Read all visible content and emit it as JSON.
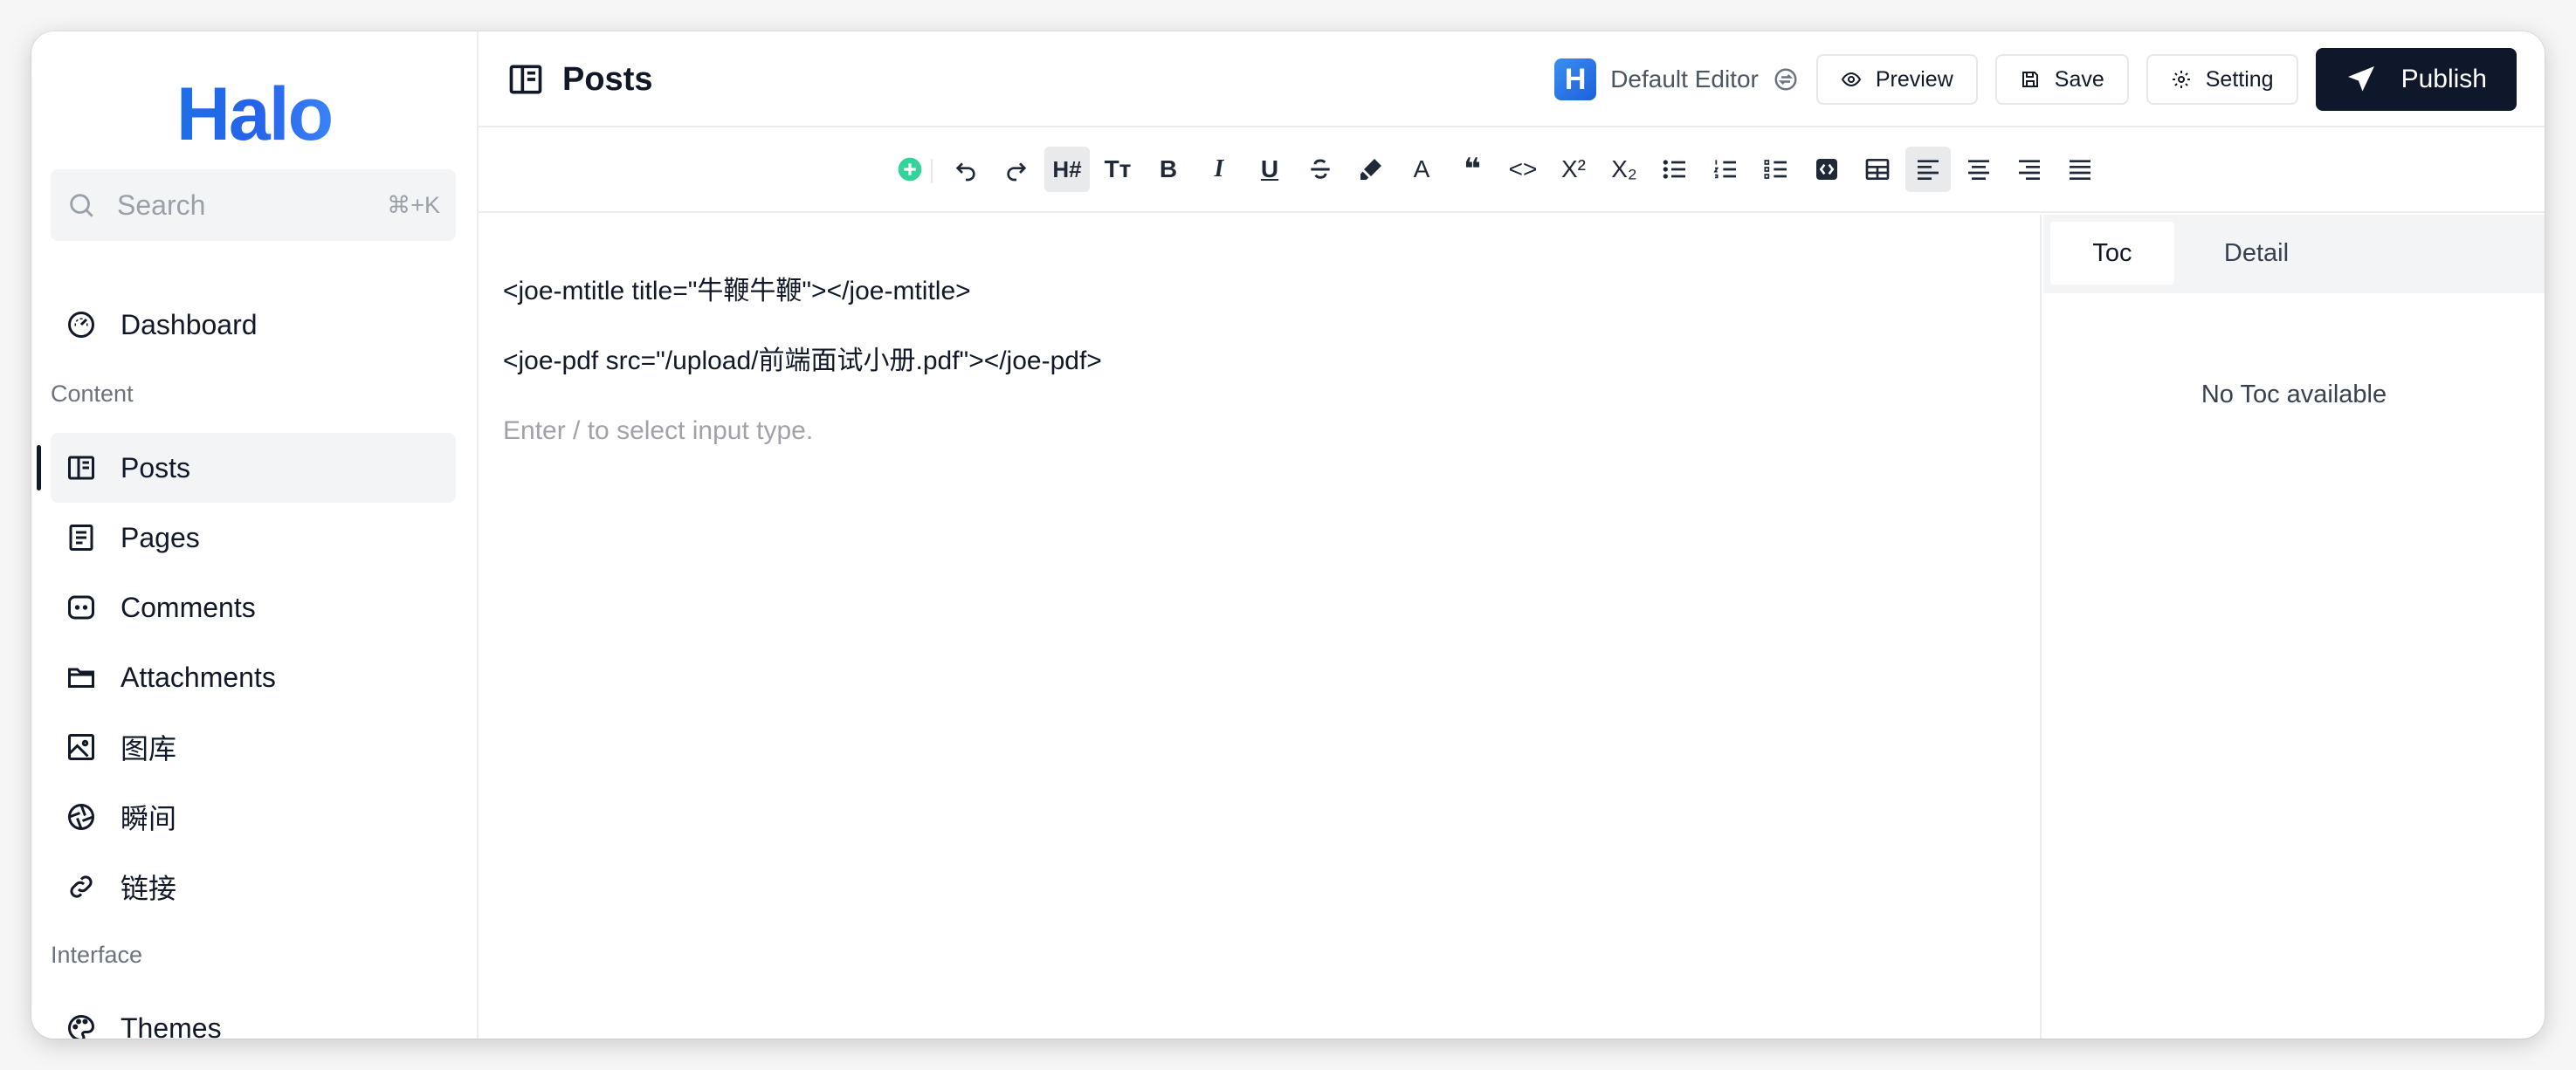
{
  "brand": {
    "logo_text": "Halo",
    "accent": "#2563eb"
  },
  "search": {
    "placeholder": "Search",
    "shortcut": "⌘+K"
  },
  "sidebar": {
    "dashboard": "Dashboard",
    "section_content": "Content",
    "items": [
      "Posts",
      "Pages",
      "Comments",
      "Attachments",
      "图库",
      "瞬间",
      "链接"
    ],
    "section_interface": "Interface",
    "themes": "Themes"
  },
  "header": {
    "title": "Posts",
    "editor_badge": "H",
    "editor_name": "Default Editor",
    "preview": "Preview",
    "save": "Save",
    "setting": "Setting",
    "publish": "Publish"
  },
  "toolbar": {
    "heading_label": "H#",
    "text_size_label": "Tт",
    "bold_label": "B",
    "italic_label": "I",
    "underline_label": "U",
    "text_color_label": "A",
    "quote_label": "❝",
    "code_label": "<>",
    "superscript_label": "X²",
    "subscript_label": "X₂",
    "icons": [
      "add-block-icon",
      "undo-icon",
      "redo-icon",
      "heading-icon",
      "text-size-icon",
      "bold-icon",
      "italic-icon",
      "underline-icon",
      "strikethrough-icon",
      "highlight-icon",
      "text-color-icon",
      "quote-icon",
      "code-icon",
      "superscript-icon",
      "subscript-icon",
      "bullet-list-icon",
      "ordered-list-icon",
      "task-list-icon",
      "code-block-icon",
      "table-icon",
      "align-left-icon",
      "align-center-icon",
      "align-right-icon",
      "align-justify-icon"
    ]
  },
  "editor": {
    "line1": "<joe-mtitle title=\"牛鞭牛鞭\"></joe-mtitle>",
    "line2": "<joe-pdf src=\"/upload/前端面试小册.pdf\"></joe-pdf>",
    "placeholder": "Enter / to select input type."
  },
  "panel": {
    "tab_toc": "Toc",
    "tab_detail": "Detail",
    "empty": "No Toc available"
  }
}
